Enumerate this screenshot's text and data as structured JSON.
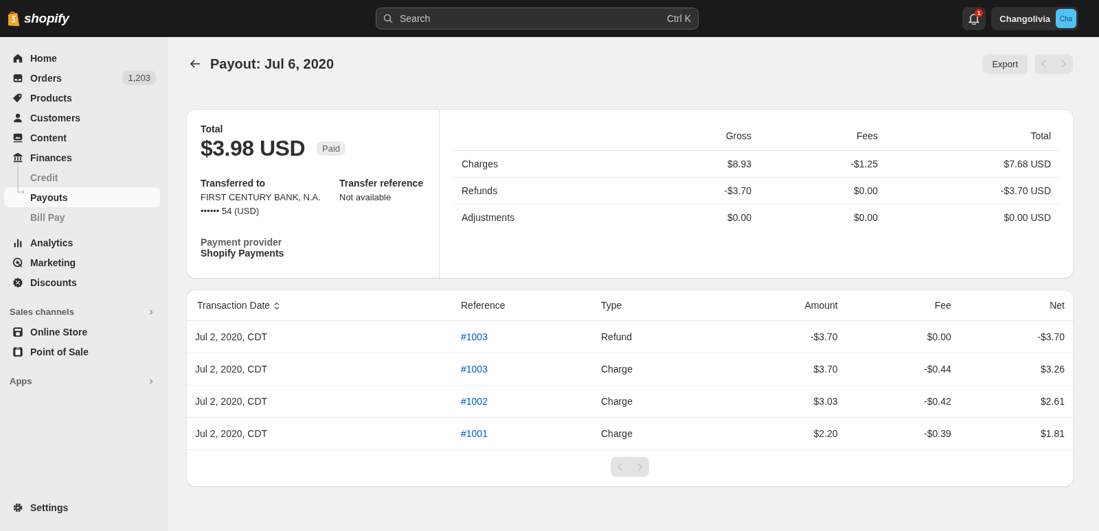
{
  "topbar": {
    "logo": "shopify",
    "search": {
      "placeholder": "Search",
      "shortcut": "Ctrl K"
    },
    "notification_count": "1",
    "account": {
      "name": "Changolivia",
      "avatar": "Cha"
    }
  },
  "sidebar": {
    "items": [
      {
        "label": "Home",
        "selected": false
      },
      {
        "label": "Orders",
        "selected": false,
        "badge": "1,203"
      },
      {
        "label": "Products",
        "selected": false
      },
      {
        "label": "Customers",
        "selected": false
      },
      {
        "label": "Content",
        "selected": false
      },
      {
        "label": "Finances",
        "selected": false,
        "expanded": true,
        "children": [
          {
            "label": "Credit",
            "selected": false
          },
          {
            "label": "Payouts",
            "selected": true
          },
          {
            "label": "Bill Pay",
            "selected": false
          }
        ]
      },
      {
        "label": "Analytics",
        "selected": false
      },
      {
        "label": "Marketing",
        "selected": false
      },
      {
        "label": "Discounts",
        "selected": false
      }
    ],
    "sections": [
      {
        "title": "Sales channels",
        "items": [
          {
            "label": "Online Store",
            "selected": false
          },
          {
            "label": "Point of Sale",
            "selected": false
          }
        ]
      },
      {
        "title": "Apps"
      }
    ],
    "settings": "Settings"
  },
  "page": {
    "title": "Payout: Jul 6, 2020",
    "export": "Export"
  },
  "summary": {
    "total_label": "Total",
    "total": "$3.98 USD",
    "status": "Paid",
    "transferred_to_label": "Transferred to",
    "bank": "FIRST CENTURY BANK, N.A.",
    "account": "•••••• 54 (USD)",
    "transfer_reference_label": "Transfer reference",
    "transfer_reference": "Not available",
    "provider_label": "Payment provider",
    "provider": "Shopify Payments",
    "columns": [
      "Gross",
      "Fees",
      "Total"
    ],
    "rows": [
      {
        "label": "Charges",
        "gross": "$8.93",
        "fees": "-$1.25",
        "total": "$7.68 USD"
      },
      {
        "label": "Refunds",
        "gross": "-$3.70",
        "fees": "$0.00",
        "total": "-$3.70 USD"
      },
      {
        "label": "Adjustments",
        "gross": "$0.00",
        "fees": "$0.00",
        "total": "$0.00 USD"
      }
    ]
  },
  "transactions": {
    "columns": [
      "Transaction Date",
      "Reference",
      "Type",
      "Amount",
      "Fee",
      "Net"
    ],
    "rows": [
      {
        "date": "Jul 2, 2020, CDT",
        "reference": "#1003",
        "type": "Refund",
        "amount": "-$3.70",
        "fee": "$0.00",
        "net": "-$3.70"
      },
      {
        "date": "Jul 2, 2020, CDT",
        "reference": "#1003",
        "type": "Charge",
        "amount": "$3.70",
        "fee": "-$0.44",
        "net": "$3.26"
      },
      {
        "date": "Jul 2, 2020, CDT",
        "reference": "#1002",
        "type": "Charge",
        "amount": "$3.03",
        "fee": "-$0.42",
        "net": "$2.61"
      },
      {
        "date": "Jul 2, 2020, CDT",
        "reference": "#1001",
        "type": "Charge",
        "amount": "$2.20",
        "fee": "-$0.39",
        "net": "$1.81"
      }
    ]
  }
}
